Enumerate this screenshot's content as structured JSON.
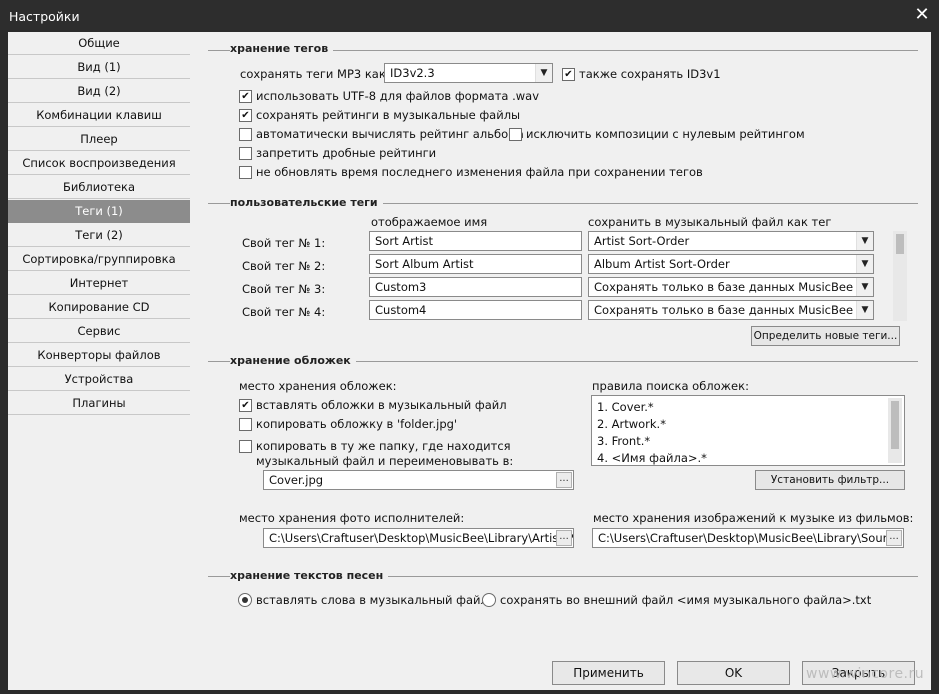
{
  "window": {
    "title": "Настройки",
    "close_glyph": "✕"
  },
  "sidebar": {
    "items": [
      {
        "label": "Общие"
      },
      {
        "label": "Вид (1)"
      },
      {
        "label": "Вид (2)"
      },
      {
        "label": "Комбинации клавиш"
      },
      {
        "label": "Плеер"
      },
      {
        "label": "Список воспроизведения"
      },
      {
        "label": "Библиотека"
      },
      {
        "label": "Теги (1)",
        "selected": true
      },
      {
        "label": "Теги (2)"
      },
      {
        "label": "Сортировка/группировка"
      },
      {
        "label": "Интернет"
      },
      {
        "label": "Копирование CD"
      },
      {
        "label": "Сервис"
      },
      {
        "label": "Конверторы файлов"
      },
      {
        "label": "Устройства"
      },
      {
        "label": "Плагины"
      }
    ]
  },
  "tag_storage": {
    "header": "хранение тегов",
    "mp3_label": "сохранять теги MP3 как:",
    "mp3_value": "ID3v2.3",
    "also_id3v1": {
      "label": "также сохранять ID3v1",
      "checked": true
    },
    "utf8_wav": {
      "label": "использовать UTF-8 для файлов формата .wav",
      "checked": true
    },
    "save_ratings": {
      "label": "сохранять рейтинги в музыкальные файлы",
      "checked": true
    },
    "auto_album_rating": {
      "label": "автоматически вычислять рейтинг альбома",
      "checked": false
    },
    "exclude_zero": {
      "label": "исключить композиции с нулевым рейтингом",
      "checked": false
    },
    "no_fractional": {
      "label": "запретить дробные рейтинги",
      "checked": false
    },
    "no_update_mtime": {
      "label": "не обновлять время последнего изменения файла при сохранении тегов",
      "checked": false
    }
  },
  "custom_tags": {
    "header": "пользовательские теги",
    "col_display": "отображаемое имя",
    "col_save_as": "сохранить в музыкальный файл как тег",
    "rows": [
      {
        "label": "Свой тег № 1:",
        "name": "Sort Artist",
        "tag": "Artist Sort-Order"
      },
      {
        "label": "Свой тег № 2:",
        "name": "Sort Album Artist",
        "tag": "Album Artist Sort-Order"
      },
      {
        "label": "Свой тег № 3:",
        "name": "Custom3",
        "tag": "Сохранять только в базе данных MusicBee"
      },
      {
        "label": "Свой тег № 4:",
        "name": "Custom4",
        "tag": "Сохранять только в базе данных MusicBee"
      }
    ],
    "define_button": "Определить новые теги..."
  },
  "artwork": {
    "header": "хранение обложек",
    "location_label": "место хранения обложек:",
    "embed": {
      "label": "вставлять обложки в музыкальный файл",
      "checked": true
    },
    "copy_folder_jpg": {
      "label": "копировать обложку в 'folder.jpg'",
      "checked": false
    },
    "copy_rename": {
      "label": "копировать в ту же папку, где находится",
      "label2": "музыкальный файл и переименовывать в:",
      "checked": false
    },
    "rename_value": "Cover.jpg",
    "search_rules_label": "правила поиска обложек:",
    "search_rules": [
      "1. Cover.*",
      "2. Artwork.*",
      "3. Front.*",
      "4. <Имя файла>.*"
    ],
    "filter_button": "Установить фильтр...",
    "artist_photo_label": "место хранения фото исполнителей:",
    "artist_photo_value": "C:\\Users\\Craftuser\\Desktop\\MusicBee\\Library\\Artist P",
    "movie_images_label": "место хранения изображений к музыке из фильмов:",
    "movie_images_value": "C:\\Users\\Craftuser\\Desktop\\MusicBee\\Library\\Soundt",
    "browse_glyph": "..."
  },
  "lyrics": {
    "header": "хранение текстов песен",
    "embed": {
      "label": "вставлять слова в музыкальный файл",
      "selected": true
    },
    "external": {
      "label": "сохранять во внешний файл <имя музыкального файла>.txt",
      "selected": false
    }
  },
  "footer": {
    "apply": "Применить",
    "ok": "OK",
    "close": "Закрыть"
  },
  "watermark": "www.wincore.ru",
  "check_glyph": "✔",
  "dropdown_glyph": "▼"
}
